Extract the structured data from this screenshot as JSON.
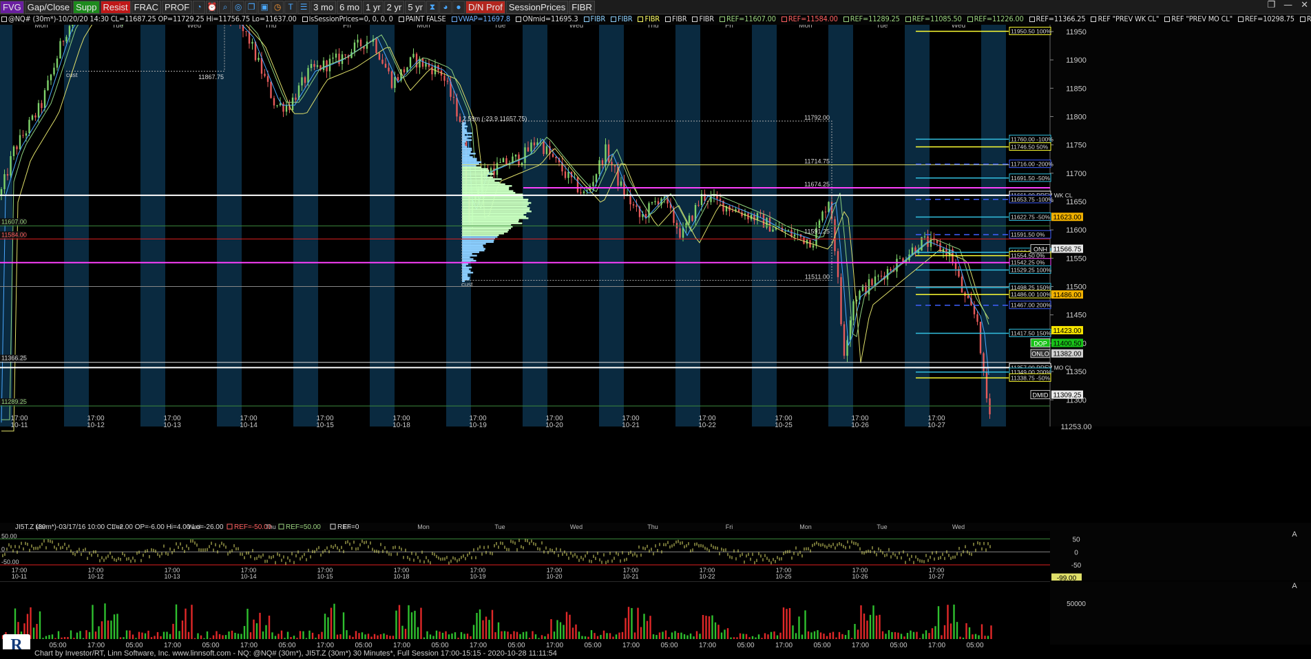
{
  "toolbar": {
    "buttons": [
      "FVG",
      "Gap/Close",
      "Supp",
      "Resist",
      "FRAC",
      "PROF",
      "3 mo",
      "6 mo",
      "1 yr",
      "2 yr",
      "5 yr",
      "D/N Prof",
      "SessionPrices",
      "FIBR"
    ],
    "button_colors": [
      "#6a1fa0",
      "#2a2a2a",
      "#1d8a1d",
      "#c01818",
      "#2a2a2a",
      "#2a2a2a",
      "#2a2a2a",
      "#2a2a2a",
      "#2a2a2a",
      "#2a2a2a",
      "#2a2a2a",
      "#b3261e",
      "#2a2a2a",
      "#2a2a2a"
    ],
    "icon_names": [
      "clock-icon",
      "alarm-icon",
      "zoom-icon",
      "target-icon",
      "copy-icon",
      "save-icon",
      "timer-icon",
      "title-icon",
      "layers-icon",
      "print-icon",
      "hourglass-icon",
      "history-icon"
    ]
  },
  "window_controls": [
    "❐",
    "—",
    "✕"
  ],
  "header": {
    "items": [
      {
        "text": "@NQ# (30m*)-10/20/20 14:30 CL=11687.25 OP=11729.25 Hi=11756.75 Lo=11637.00",
        "color": "#dddddd"
      },
      {
        "text": "lsSessionPrices=0, 0, 0, 0",
        "color": "#dddddd"
      },
      {
        "text": "PAINT FALSE",
        "color": "#dddddd"
      },
      {
        "text": "VWAP=11697.8",
        "color": "#6fb2ff"
      },
      {
        "text": "ONmid=11695.3",
        "color": "#dddddd"
      },
      {
        "text": "FIBR",
        "color": "#8fd2ff"
      },
      {
        "text": "FIBR",
        "color": "#8fd2ff"
      },
      {
        "text": "FIBR",
        "color": "#ffff66"
      },
      {
        "text": "FIBR",
        "color": "#dddddd"
      },
      {
        "text": "FIBR",
        "color": "#dddddd"
      },
      {
        "text": "REF=11607.00",
        "color": "#9bd37f"
      },
      {
        "text": "REF=11584.00",
        "color": "#ff6060"
      },
      {
        "text": "REF=11289.25",
        "color": "#9bd37f"
      },
      {
        "text": "REF=11085.50",
        "color": "#9bd37f"
      },
      {
        "text": "REF=11226.00",
        "color": "#9bd37f"
      },
      {
        "text": "REF=11366.25",
        "color": "#dddddd"
      },
      {
        "text": "REF \"PREV WK CL\"",
        "color": "#dddddd"
      },
      {
        "text": "REF \"PREV MO CL\"",
        "color": "#dddddd"
      },
      {
        "text": "REF=10298.75",
        "color": "#dddddd"
      },
      {
        "text": "REF=",
        "color": "#dddddd"
      }
    ]
  },
  "price_axis": {
    "ticks": [
      "11950",
      "11900",
      "11850",
      "11800",
      "11750",
      "11700",
      "11650",
      "11600",
      "11550",
      "11500",
      "11450",
      "11400",
      "11350",
      "11300",
      "11253.00"
    ]
  },
  "price_tags": [
    {
      "text": "11623.00",
      "price": 11623.0,
      "bg": "#f0b000",
      "fg": "#000"
    },
    {
      "text": "11566.75",
      "price": 11566.75,
      "bg": "#e8e8e8",
      "fg": "#000"
    },
    {
      "text": "11486.00",
      "price": 11486.0,
      "bg": "#f0b000",
      "fg": "#000"
    },
    {
      "text": "11423.00",
      "price": 11423.0,
      "bg": "#f5e300",
      "fg": "#000"
    },
    {
      "text": "11400.50",
      "price": 11400.5,
      "bg": "#19c219",
      "fg": "#000"
    },
    {
      "text": "11382.00",
      "price": 11382.0,
      "bg": "#d0d0d0",
      "fg": "#000"
    },
    {
      "text": "11309.25",
      "price": 11309.25,
      "bg": "#e8e8e8",
      "fg": "#000"
    }
  ],
  "price_range": [
    11253,
    11962
  ],
  "left_labels": [
    {
      "text": "11607.00",
      "price": 11607.0,
      "color": "#9bd37f"
    },
    {
      "text": "11584.00",
      "price": 11584.0,
      "color": "#ff6060"
    },
    {
      "text": "11366.25",
      "price": 11366.25,
      "color": "#dddddd"
    },
    {
      "text": "11289.25",
      "price": 11289.25,
      "color": "#9bd37f"
    }
  ],
  "days_top": [
    "Mon",
    "Tue",
    "Wed",
    "Thu",
    "Fri",
    "Mon",
    "Tue",
    "Wed",
    "Thu",
    "Fri",
    "Mon",
    "Tue",
    "Wed"
  ],
  "session_times": [
    "17:00",
    "17:00",
    "17:00",
    "17:00",
    "17:00",
    "17:00",
    "17:00",
    "17:00",
    "17:00",
    "17:00",
    "17:00",
    "17:00",
    "17:00"
  ],
  "session_dates": [
    "10-11",
    "10-12",
    "10-13",
    "10-14",
    "10-15",
    "10-18",
    "10-19",
    "10-20",
    "10-21",
    "10-22",
    "10-25",
    "10-26",
    "10-27"
  ],
  "profile": {
    "labels": [
      {
        "text": "2.59m (-23.9 11657.75)",
        "price": 11790
      },
      {
        "text": "11792.00",
        "price": 11792.0
      },
      {
        "text": "11714.75",
        "price": 11714.75
      },
      {
        "text": "11674.25",
        "price": 11674.25
      },
      {
        "text": "11591.25",
        "price": 11591.25
      },
      {
        "text": "11511.00",
        "price": 11511.0
      }
    ],
    "cust_label": "cust"
  },
  "top_left_labels": {
    "cust": "cust",
    "level": "11867.75"
  },
  "fib_levels": [
    {
      "text": "11950.50 100%",
      "price": 11950.5,
      "color": "#ffff33"
    },
    {
      "text": "11760.00 -100%",
      "price": 11760.0,
      "color": "#33c0e0"
    },
    {
      "text": "11746.50 50%",
      "price": 11746.5,
      "color": "#ffff33"
    },
    {
      "text": "11716.00 -200%",
      "price": 11716.0,
      "color": "#4060ff"
    },
    {
      "text": "11691.50 -50%",
      "price": 11691.5,
      "color": "#33c0e0"
    },
    {
      "text": "11661.00 PREV WK CL",
      "price": 11661.0,
      "color": "#ffffff"
    },
    {
      "text": "11653.75 -100%",
      "price": 11653.75,
      "color": "#4060ff"
    },
    {
      "text": "11622.75 -50%",
      "price": 11622.75,
      "color": "#33c0e0"
    },
    {
      "text": "11591.50 0%",
      "price": 11591.5,
      "color": "#4060ff"
    },
    {
      "text": "11560.50 50%",
      "price": 11560.5,
      "color": "#33c0e0"
    },
    {
      "text": "11554.50 0%",
      "price": 11554.5,
      "color": "#ffff33"
    },
    {
      "text": "11542.25 0%",
      "price": 11542.25,
      "color": "#ff40ff"
    },
    {
      "text": "11529.25 100%",
      "price": 11529.25,
      "color": "#33c0e0"
    },
    {
      "text": "11498.25 150%",
      "price": 11498.25,
      "color": "#33c0e0"
    },
    {
      "text": "11486.00 100%",
      "price": 11486.0,
      "color": "#ffff33"
    },
    {
      "text": "11467.00 200%",
      "price": 11467.0,
      "color": "#4060ff"
    },
    {
      "text": "11417.50 150%",
      "price": 11417.5,
      "color": "#33c0e0"
    },
    {
      "text": "11357.00 PREV MO CL",
      "price": 11357.0,
      "color": "#ffffff"
    },
    {
      "text": "11349.00 200%",
      "price": 11349.0,
      "color": "#33c0e0"
    },
    {
      "text": "11338.75 -50%",
      "price": 11338.75,
      "color": "#ffff33"
    }
  ],
  "side_tags": [
    {
      "text": "DOP",
      "price": 11400.5,
      "bg": "#19c219"
    },
    {
      "text": "ONLO",
      "price": 11382.0,
      "bg": "#333"
    },
    {
      "text": "DMID",
      "price": 11309.25,
      "bg": "#000"
    },
    {
      "text": "ONH",
      "price": 11566.75,
      "bg": "#000"
    }
  ],
  "indicator": {
    "header": "JI5T.Z (30m*)-03/17/16 10:00 CL=2.00 OP=-6.00 Hi=4.00 Lo=-26.00",
    "refs": [
      {
        "text": "REF=-50.00",
        "color": "#ff6060"
      },
      {
        "text": "REF=50.00",
        "color": "#9bd37f"
      },
      {
        "text": "REF=0",
        "color": "#dddddd"
      }
    ],
    "left_labels": [
      "50.00",
      "0",
      "-50.00"
    ],
    "axis_ticks": [
      "50",
      "0",
      "-50"
    ],
    "tag": "-99.00",
    "range": [
      -100,
      75
    ],
    "days": [
      "Mon",
      "Tue",
      "Wed",
      "Thu",
      "Fri",
      "Mon",
      "Tue",
      "Wed",
      "Thu",
      "Fri",
      "Mon",
      "Tue",
      "Wed"
    ]
  },
  "volume": {
    "axis_ticks": [
      "50000"
    ],
    "axis_max": 75000
  },
  "time_axis": [
    "05:00",
    "17:00",
    "05:00",
    "17:00",
    "05:00",
    "17:00",
    "05:00",
    "17:00",
    "05:00",
    "17:00",
    "05:00",
    "17:00",
    "05:00",
    "17:00",
    "05:00",
    "17:00",
    "05:00",
    "17:00",
    "05:00",
    "17:00",
    "05:00",
    "17:00",
    "05:00",
    "17:00",
    "05:00"
  ],
  "footer": "Chart by Investor/RT, Linn Software, Inc. www.linnsoft.com - NQ: @NQ# (30m*), JI5T.Z (30m*) 30 Minutes*, Full Session 17:00-15:15 - 2020-10-28 11:11:54",
  "panel_letters": [
    "A",
    "A",
    "A"
  ],
  "logo_text": "R"
}
